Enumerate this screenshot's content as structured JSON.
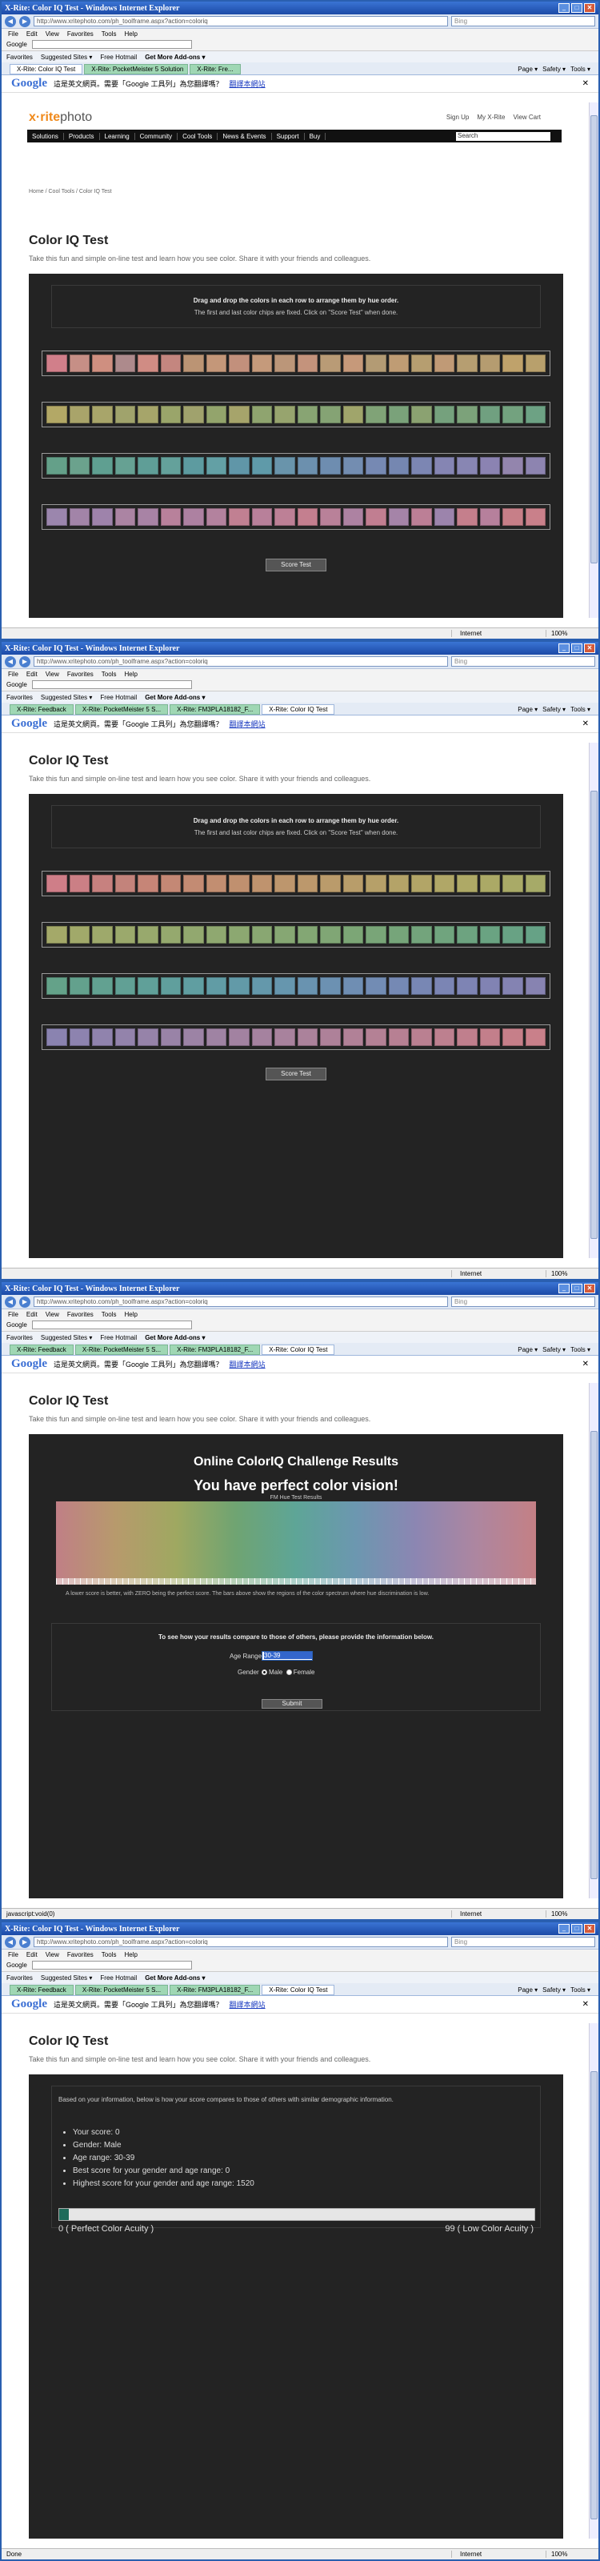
{
  "browser": {
    "title": "X-Rite: Color IQ Test - Windows Internet Explorer",
    "url": "http://www.xritephoto.com/ph_toolframe.aspx?action=coloriq",
    "search_placeholder": "Bing",
    "menus": [
      "File",
      "Edit",
      "View",
      "Favorites",
      "Tools",
      "Help"
    ],
    "google_toolbar": "Google",
    "favorites": [
      "Favorites",
      "Suggested Sites ▾",
      "Free Hotmail",
      "Get More Add-ons ▾"
    ],
    "tabs_w1": [
      "X-Rite: Color IQ Test",
      "X-Rite: PocketMeister 5 Solution",
      "X-Rite: Fre..."
    ],
    "tabs_w2": [
      "X-Rite: Feedback",
      "X-Rite: PocketMeister 5 S...",
      "X-Rite: FM3PLA18182_F...",
      "X-Rite: Color IQ Test"
    ],
    "tab_tools": [
      "Page ▾",
      "Safety ▾",
      "Tools ▾"
    ],
    "translate_text": "這是英文網頁。需要「Google 工具列」為您翻譯嗎？",
    "translate_link": "翻譯本網站",
    "status_internet": "Internet",
    "status_zoom": "100%",
    "status_text_w3": "javascript:void(0)",
    "status_text_w4": "Done"
  },
  "site": {
    "logo_brand": "x·rite",
    "logo_product": "photo",
    "top_links": [
      "Sign Up",
      "My X-Rite",
      "View Cart"
    ],
    "nav": [
      "Solutions",
      "Products",
      "Learning",
      "Community",
      "Cool Tools",
      "News & Events",
      "Support",
      "Buy"
    ],
    "search_value": "Search",
    "breadcrumb": "Home  /  Cool Tools  /  Color IQ Test",
    "page_title": "Color IQ Test",
    "intro": "Take this fun and simple on-line test and learn how you see color. Share it with your friends and colleagues."
  },
  "test": {
    "instruction_1": "Drag and drop the colors in each row to arrange them by hue order.",
    "instruction_2": "The first and last color chips are fixed. Click on \"Score Test\" when done.",
    "score_button": "Score Test",
    "rows_w1": [
      [
        "#d17f8a",
        "#c68f86",
        "#cf8f80",
        "#ad8a8c",
        "#d08c84",
        "#c4867f",
        "#bb9474",
        "#c49779",
        "#c2907c",
        "#c59a7b",
        "#bb9679",
        "#c4937c",
        "#b99b76",
        "#c6997a",
        "#b39b74",
        "#bf9c74",
        "#b69e70",
        "#c09a76",
        "#b69e71",
        "#b59c70",
        "#bfa26b",
        "#b8a06c"
      ],
      [
        "#b3a866",
        "#a9a46a",
        "#a8a56a",
        "#a0a36c",
        "#a6a56a",
        "#9aa56a",
        "#a0a26d",
        "#93a46c",
        "#a6a46b",
        "#8fa46f",
        "#97a46e",
        "#88a473",
        "#85a374",
        "#a0a56b",
        "#80a377",
        "#7aa27a",
        "#8ba271",
        "#75a17d",
        "#7ca27a",
        "#70a080",
        "#73a27f",
        "#6da284"
      ],
      [
        "#64a089",
        "#6ba28d",
        "#5f9f91",
        "#66a193",
        "#5f9e97",
        "#64a19b",
        "#5d9ba0",
        "#63a0a5",
        "#6096a8",
        "#5f9aa9",
        "#6994ab",
        "#6c90ae",
        "#6e8db0",
        "#738db1",
        "#7689b3",
        "#7587b1",
        "#7c86b3",
        "#8585b3",
        "#8886b3",
        "#8b83b2",
        "#9385ad",
        "#8d84b0"
      ],
      [
        "#9b86ad",
        "#a284a8",
        "#9e83ab",
        "#ab84a3",
        "#a883a5",
        "#b8819b",
        "#ad81a1",
        "#b3829e",
        "#c18092",
        "#b8809a",
        "#bd8096",
        "#c47f8f",
        "#b98199",
        "#ad82a2",
        "#c17e91",
        "#a584a8",
        "#bc7f96",
        "#9c84ac",
        "#c57f8c",
        "#b6809c",
        "#c77f88",
        "#c9808a"
      ]
    ],
    "rows_w2": [
      [
        "#cf7e88",
        "#cb7f85",
        "#c7817f",
        "#c3837b",
        "#c68577",
        "#c48875",
        "#c38b73",
        "#c28e71",
        "#c0906f",
        "#bf936e",
        "#bd966d",
        "#bc986c",
        "#ba9b6b",
        "#b89d6a",
        "#b6a069",
        "#b4a368",
        "#b2a567",
        "#b0a767",
        "#aea966",
        "#aba966",
        "#a9aa67",
        "#a6aa68"
      ],
      [
        "#a4a969",
        "#a1a96a",
        "#9ea96b",
        "#9ba96c",
        "#98a96d",
        "#95a96e",
        "#92a86f",
        "#8fa870",
        "#8ca871",
        "#89a772",
        "#86a773",
        "#83a774",
        "#80a675",
        "#7ca676",
        "#79a578",
        "#76a57a",
        "#73a47c",
        "#70a47e",
        "#6da380",
        "#6aa382",
        "#68a284",
        "#66a286"
      ],
      [
        "#64a289",
        "#63a18d",
        "#62a191",
        "#61a095",
        "#60a099",
        "#609f9d",
        "#609ea1",
        "#619ca5",
        "#629aa8",
        "#6498ab",
        "#6696ae",
        "#6993b0",
        "#6c91b2",
        "#6f8eb3",
        "#728cb4",
        "#7589b4",
        "#7887b4",
        "#7b85b4",
        "#7e84b4",
        "#8183b3",
        "#8483b2",
        "#8783b1"
      ],
      [
        "#8a83b0",
        "#8d83af",
        "#9083ad",
        "#9383ab",
        "#9683a9",
        "#9983a7",
        "#9c83a5",
        "#9f83a3",
        "#a282a1",
        "#a5829f",
        "#a8829d",
        "#ab829b",
        "#ae8199",
        "#b18197",
        "#b48195",
        "#b78093",
        "#ba8091",
        "#bd808f",
        "#c07f8d",
        "#c37f8b",
        "#c67f89",
        "#c9808a"
      ]
    ]
  },
  "results": {
    "heading": "Online ColorIQ Challenge Results",
    "perfect": "You have perfect color vision!",
    "chart_label": "FM Hue Test Results",
    "note": "A lower score is better, with ZERO being the perfect score. The bars above show the regions of the color spectrum where hue discrimination is low.",
    "compare_prompt": "To see how your results compare to those of others, please provide the information below.",
    "age_label": "Age Range",
    "age_value": "30-39",
    "gender_label": "Gender",
    "gender_options": [
      "Male",
      "Female"
    ],
    "gender_selected": "Male",
    "submit": "Submit"
  },
  "summary": {
    "intro": "Based on your information, below is how your score compares to those of others with similar demographic information.",
    "items": [
      "Your score: 0",
      "Gender: Male",
      "Age range: 30-39",
      "Best score for your gender and age range: 0",
      "Highest score for your gender and age range: 1520"
    ],
    "acuity_fraction": 0.02,
    "acuity_fill_color": "#1e6b5a",
    "label_left": "0 ( Perfect Color Acuity )",
    "label_right": "99 ( Low Color Acuity )"
  }
}
